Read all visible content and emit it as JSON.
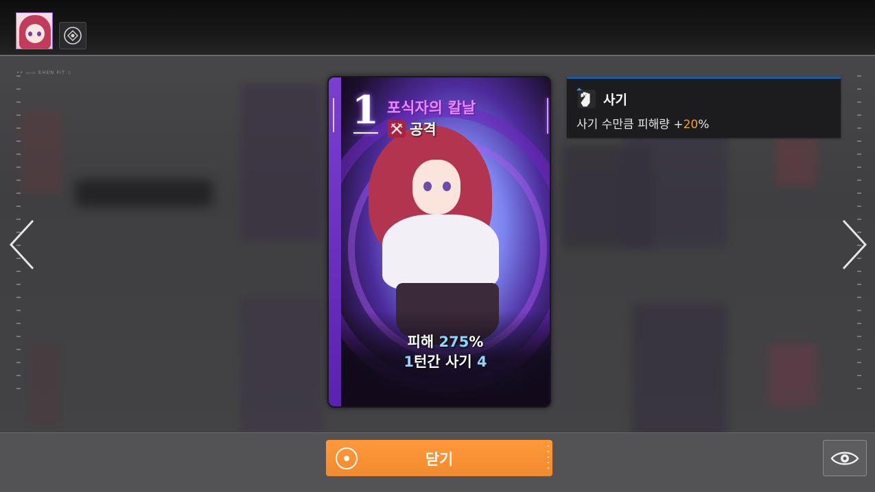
{
  "card": {
    "cost": "1",
    "name": "포식자의 칼날",
    "type_label": "공격",
    "type_icon": "crossed-swords-icon",
    "effect_line1": {
      "prefix": "피해 ",
      "value": "275",
      "suffix": "%"
    },
    "effect_line2": {
      "value1": "1",
      "middle": "턴간 사기 ",
      "value2": "4"
    }
  },
  "tooltip": {
    "icon": "raised-fist-icon",
    "title": "사기",
    "desc_prefix": "사기 수만큼 피해량 +",
    "desc_value": "20",
    "desc_suffix": "%"
  },
  "actions": {
    "close_label": "닫기"
  },
  "colors": {
    "accent_orange": "#f28a2e",
    "card_name_purple": "#e58cff",
    "highlight_blue": "#8fd6ff",
    "tooltip_number": "#f0a52a"
  }
}
